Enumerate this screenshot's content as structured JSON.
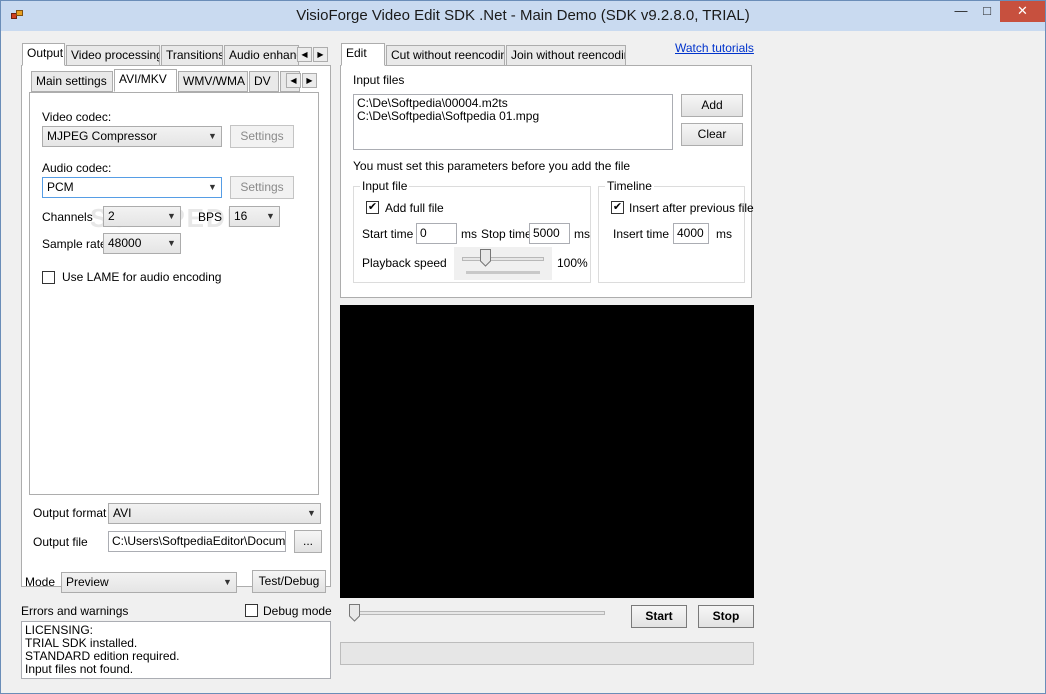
{
  "window": {
    "title": "VisioForge Video Edit SDK .Net - Main Demo (SDK v9.2.8.0, TRIAL)",
    "minimize": "—",
    "maximize": "□",
    "close": "✕"
  },
  "left_tabs": [
    "Output",
    "Video processing",
    "Transitions",
    "Audio enhance"
  ],
  "output_tabs": [
    "Main settings",
    "AVI/MKV",
    "WMV/WMA",
    "DV",
    "P"
  ],
  "avi": {
    "video_codec_label": "Video codec:",
    "video_codec_value": "MJPEG Compressor",
    "settings_label": "Settings",
    "audio_codec_label": "Audio codec:",
    "audio_codec_value": "PCM",
    "channels_label": "Channels",
    "channels_value": "2",
    "bps_label": "BPS",
    "bps_value": "16",
    "sample_rate_label": "Sample rate",
    "sample_rate_value": "48000",
    "lame_label": "Use LAME for audio encoding",
    "lame_checked": false
  },
  "output": {
    "format_label": "Output format",
    "format_value": "AVI",
    "file_label": "Output file",
    "file_value": "C:\\Users\\SoftpediaEditor\\Document",
    "browse_label": "..."
  },
  "mode": {
    "label": "Mode",
    "value": "Preview",
    "test_button": "Test/Debug"
  },
  "errors": {
    "label": "Errors and warnings",
    "debug_label": "Debug mode",
    "log_lines": [
      "LICENSING:",
      "TRIAL SDK installed.",
      "STANDARD edition required.",
      "Input files not found."
    ]
  },
  "edit_tabs": [
    "Edit",
    "Cut without reencoding",
    "Join without reencoding"
  ],
  "watch_tutorials": "Watch tutorials",
  "input_files": {
    "label": "Input files",
    "files": [
      "C:\\De\\Softpedia\\00004.m2ts",
      "C:\\De\\Softpedia\\Softpedia 01.mpg"
    ],
    "add_button": "Add",
    "clear_button": "Clear",
    "notice": "You must set this parameters before you add the file"
  },
  "input_file_group": {
    "title": "Input file",
    "add_full_label": "Add full file",
    "add_full_checked": true,
    "start_label": "Start time",
    "start_value": "0",
    "ms": "ms",
    "stop_label": "Stop time",
    "stop_value": "5000",
    "playback_label": "Playback speed",
    "playback_value": "100%",
    "playback_level": 0.5
  },
  "timeline_group": {
    "title": "Timeline",
    "insert_after_label": "Insert after previous file",
    "insert_after_checked": true,
    "insert_time_label": "Insert time",
    "insert_time_value": "4000",
    "ms": "ms"
  },
  "playback": {
    "start_button": "Start",
    "stop_button": "Stop",
    "position": 0,
    "progress": 0
  },
  "colors": {
    "titlebar": "#c9daf0",
    "close": "#c7503e",
    "preview": "#000000",
    "link": "#0033cc"
  },
  "icons": {
    "check": "✔",
    "dropdown": "▼",
    "arrow_left": "◀",
    "arrow_right": "▶"
  }
}
